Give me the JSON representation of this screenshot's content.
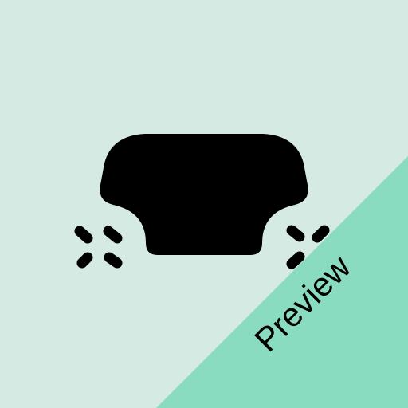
{
  "icon": {
    "name": "car-front-icon",
    "color": "#000000"
  },
  "badge": {
    "label": "Preview",
    "background": "#8adcc0",
    "text_color": "#000000"
  },
  "page": {
    "background": "#d4eae3"
  }
}
